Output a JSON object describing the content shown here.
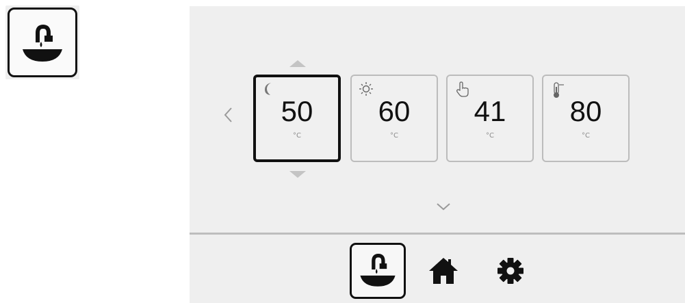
{
  "app_icon": {
    "icon": "faucet-icon"
  },
  "temperature_cards": [
    {
      "mode": "night",
      "icon": "moon-icon",
      "value": "50",
      "unit": "°C",
      "selected": true
    },
    {
      "mode": "day",
      "icon": "sun-icon",
      "value": "60",
      "unit": "°C",
      "selected": false
    },
    {
      "mode": "manual",
      "icon": "hand-pointer-icon",
      "value": "41",
      "unit": "°C",
      "selected": false
    },
    {
      "mode": "max",
      "icon": "thermometer-icon",
      "value": "80",
      "unit": "°C",
      "selected": false
    }
  ],
  "navigation": {
    "left_arrow": "chevron-left-icon",
    "increase": "triangle-up-icon",
    "decrease": "triangle-down-icon",
    "more": "chevron-down-icon"
  },
  "bottom_nav": [
    {
      "name": "hot-water",
      "icon": "faucet-icon",
      "active": true
    },
    {
      "name": "home",
      "icon": "home-icon",
      "active": false
    },
    {
      "name": "settings",
      "icon": "gear-icon",
      "active": false
    }
  ],
  "colors": {
    "panel_bg": "#efefef",
    "selected_border": "#111111",
    "card_border": "#bcbcbc",
    "arrow_gray": "#c4c4c4",
    "divider": "#bdbdbd"
  }
}
